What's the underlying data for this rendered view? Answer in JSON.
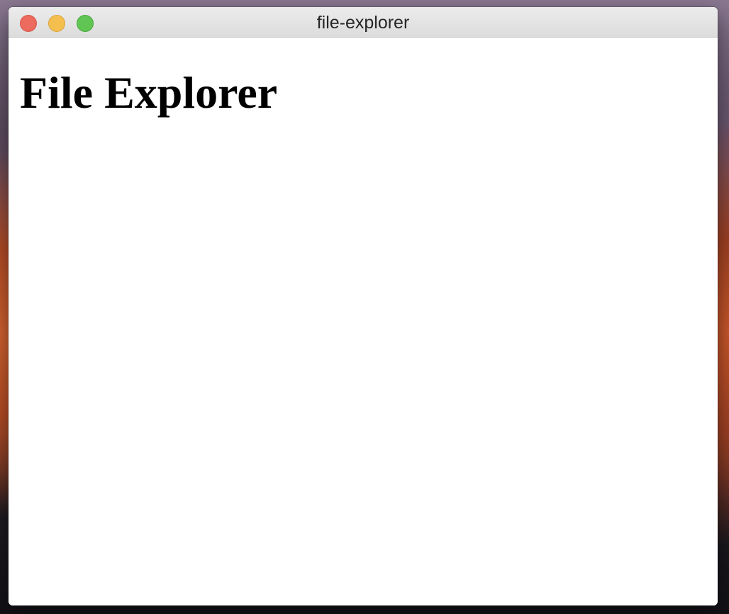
{
  "window": {
    "title": "file-explorer",
    "controls": {
      "close_color": "#ed6a5e",
      "minimize_color": "#f5bf4f",
      "maximize_color": "#61c554"
    }
  },
  "main": {
    "heading": "File Explorer"
  }
}
